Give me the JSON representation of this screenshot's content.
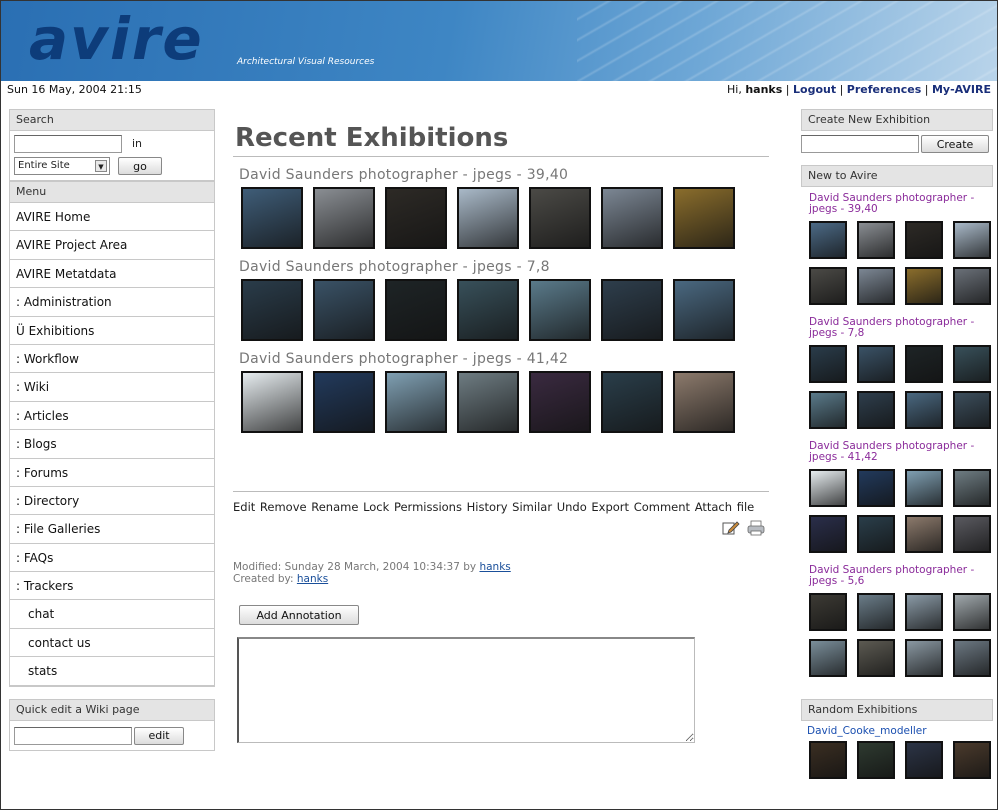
{
  "header": {
    "logo": "avire",
    "subtitle": "Architectural Visual Resources"
  },
  "infobar": {
    "datetime": "Sun 16 May, 2004 21:15",
    "greeting": "Hi, ",
    "username": "hanks",
    "links": [
      "Logout",
      "Preferences",
      "My-AVIRE"
    ]
  },
  "search": {
    "heading": "Search",
    "in_label": "in",
    "scope": "Entire Site",
    "go_label": "go"
  },
  "menu": {
    "heading": "Menu",
    "items": [
      "AVIRE Home",
      "AVIRE Project Area",
      "AVIRE Metatdata",
      ": Administration",
      "Ü Exhibitions",
      ": Workflow",
      ": Wiki",
      ": Articles",
      ": Blogs",
      ": Forums",
      ": Directory",
      ": File Galleries",
      ": FAQs",
      ": Trackers",
      "chat",
      "contact us",
      "stats"
    ]
  },
  "quick_edit": {
    "heading": "Quick edit a Wiki page",
    "edit_label": "edit"
  },
  "main": {
    "title": "Recent Exhibitions",
    "exhibitions": [
      {
        "title": "David Saunders photographer - jpegs - 39,40",
        "thumbs": [
          "#3f5d78",
          "#8a8e93",
          "#2d2a26",
          "#a9b9c8",
          "#4b4a46",
          "#7c8794",
          "#8a6d2c"
        ]
      },
      {
        "title": "David Saunders photographer - jpegs - 7,8",
        "thumbs": [
          "#2a3c4a",
          "#3a5266",
          "#1e2426",
          "#38505a",
          "#5a7a8a",
          "#2e3e4c",
          "#4a6880"
        ]
      },
      {
        "title": "David Saunders photographer - jpegs - 41,42",
        "thumbs": [
          "#e6ecef",
          "#223a5c",
          "#7f9fb2",
          "#6e7c82",
          "#3a2a40",
          "#2a3e4a",
          "#8c7a6c"
        ]
      }
    ],
    "actions": "Edit Remove Rename Lock Permissions History Similar Undo Export Comment Attach file",
    "modified_label": "Modified: Sunday 28 March, 2004 10:34:37 by ",
    "modified_by": "hanks",
    "created_label": "Created by: ",
    "created_by": "hanks",
    "annotation_button": "Add Annotation"
  },
  "right": {
    "create_heading": "Create New Exhibition",
    "create_label": "Create",
    "new_heading": "New to Avire",
    "new_exhibitions": [
      {
        "title": "David Saunders photographer - jpegs - 39,40",
        "thumbs": [
          "#4c6a86",
          "#8a8e93",
          "#2d2a26",
          "#a9b9c8",
          "#4b4a46",
          "#7c8794",
          "#8a6d2c",
          "#6a7078"
        ]
      },
      {
        "title": "David Saunders photographer - jpegs - 7,8",
        "thumbs": [
          "#2a3c4a",
          "#3a5266",
          "#1e2426",
          "#38505a",
          "#5a7a8a",
          "#2e3e4c",
          "#4a6880",
          "#3c4e5c"
        ]
      },
      {
        "title": "David Saunders photographer - jpegs - 41,42",
        "thumbs": [
          "#e6ecef",
          "#223a5c",
          "#7f9fb2",
          "#6e7c82",
          "#2a2e4a",
          "#2a3e4a",
          "#8c7a6c",
          "#5a5a60"
        ]
      },
      {
        "title": "David Saunders photographer - jpegs - 5,6",
        "thumbs": [
          "#3c3a34",
          "#6a7c88",
          "#8a9aa6",
          "#a0a8ac",
          "#7a8e9a",
          "#5c5a52",
          "#8a98a2",
          "#6c7882"
        ]
      }
    ],
    "random_heading": "Random Exhibitions",
    "random_title": "David_Cooke_modeller",
    "random_thumbs": [
      "#3a2e22",
      "#2e3a30",
      "#2c3446",
      "#4a3a2c"
    ]
  }
}
